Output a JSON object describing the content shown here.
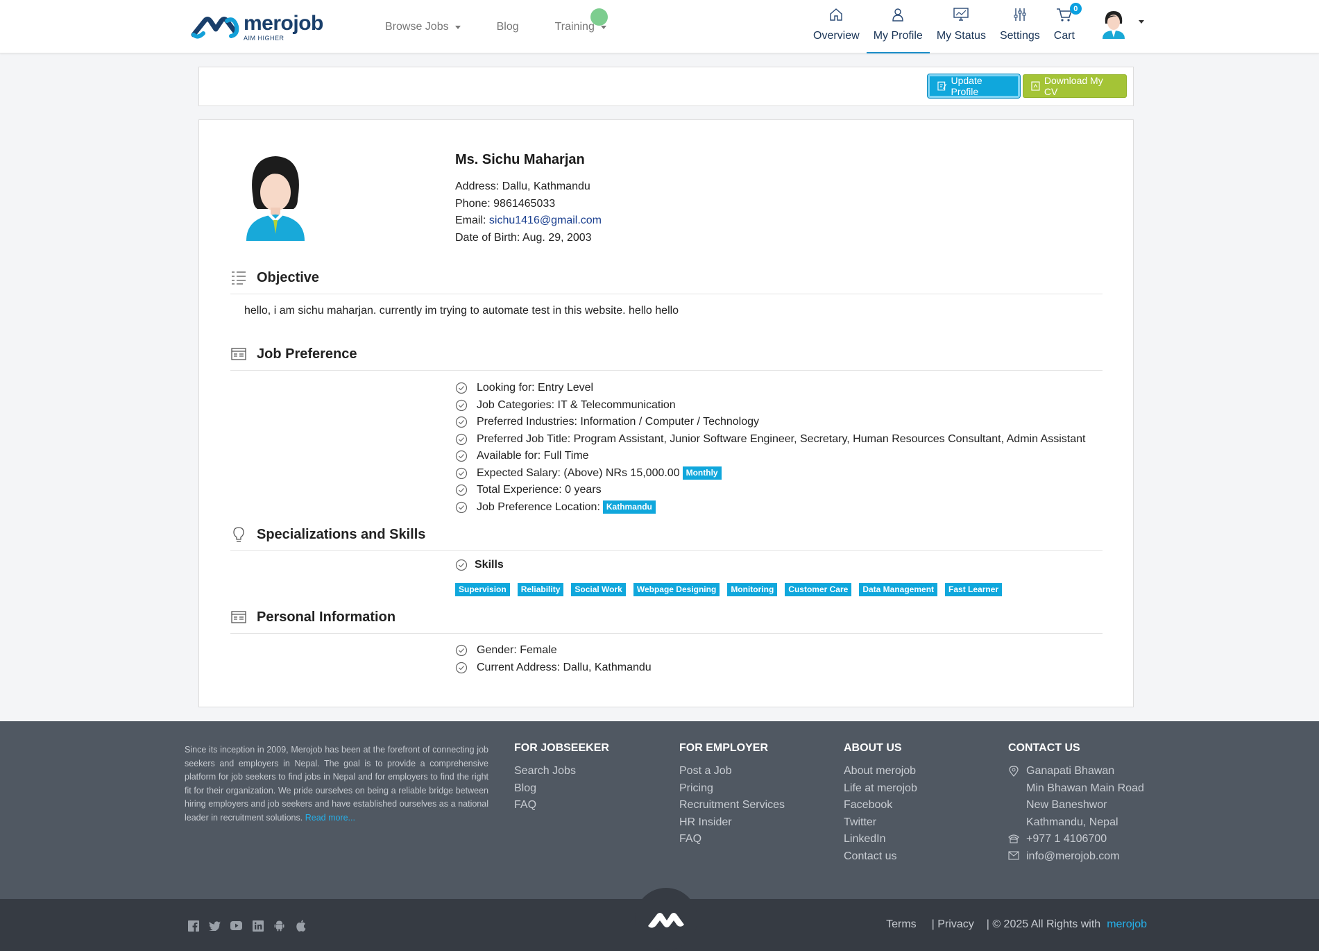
{
  "brand": {
    "name": "merojob",
    "tagline": "AIM HIGHER"
  },
  "nav": {
    "main": [
      {
        "label": "Browse Jobs",
        "dropdown": true
      },
      {
        "label": "Blog",
        "dropdown": false
      },
      {
        "label": "Training",
        "dropdown": true
      }
    ],
    "user": [
      {
        "label": "Overview",
        "icon": "home-icon"
      },
      {
        "label": "My Profile",
        "icon": "user-icon",
        "active": true
      },
      {
        "label": "My Status",
        "icon": "monitor-icon"
      },
      {
        "label": "Settings",
        "icon": "sliders-icon"
      },
      {
        "label": "Cart",
        "icon": "cart-icon",
        "badge": "0"
      }
    ]
  },
  "actions": {
    "update": "Update Profile",
    "download": "Download My CV"
  },
  "profile": {
    "name": "Ms. Sichu Maharjan",
    "address": "Address: Dallu, Kathmandu",
    "phone": "Phone: 9861465033",
    "email_label": "Email: ",
    "email": "sichu1416@gmail.com",
    "dob": "Date of Birth: Aug. 29, 2003"
  },
  "objective": {
    "title": "Objective",
    "text": "hello, i am sichu maharjan. currently im trying to automate test in this website. hello hello"
  },
  "job_preference": {
    "title": "Job Preference",
    "items": [
      "Looking for: Entry Level",
      "Job Categories: IT & Telecommunication",
      "Preferred Industries: Information / Computer / Technology",
      "Preferred Job Title: Program Assistant, Junior Software Engineer, Secretary, Human Resources Consultant, Admin Assistant",
      "Available for: Full Time",
      "Expected Salary: (Above) NRs 15,000.00",
      "Total Experience: 0 years",
      "Job Preference Location:"
    ],
    "salary_badge": "Monthly",
    "location_badge": "Kathmandu"
  },
  "skills": {
    "title": "Specializations and Skills",
    "label": "Skills",
    "items": [
      "Supervision",
      "Reliability",
      "Social Work",
      "Webpage Designing",
      "Monitoring",
      "Customer Care",
      "Data Management",
      "Fast Learner"
    ]
  },
  "personal": {
    "title": "Personal Information",
    "items": [
      "Gender: Female",
      "Current Address: Dallu, Kathmandu"
    ]
  },
  "footer": {
    "about": "Since its inception in 2009, Merojob has been at the forefront of connecting job seekers and employers in Nepal. The goal is to provide a comprehensive platform for job seekers to find jobs in Nepal and for employers to find the right fit for their organization. We pride ourselves on being a reliable bridge between hiring employers and job seekers and have established ourselves as a national leader in recruitment solutions.",
    "read_more": "Read more...",
    "jobseeker": {
      "title": "FOR JOBSEEKER",
      "links": [
        "Search Jobs",
        "Blog",
        "FAQ"
      ]
    },
    "employer": {
      "title": "FOR EMPLOYER",
      "links": [
        "Post a Job",
        "Pricing",
        "Recruitment Services",
        "HR Insider",
        "FAQ"
      ]
    },
    "about_us": {
      "title": "ABOUT US",
      "links": [
        "About merojob",
        "Life at merojob",
        "Facebook",
        "Twitter",
        "LinkedIn",
        "Contact us"
      ]
    },
    "contact": {
      "title": "CONTACT US",
      "address": [
        "Ganapati Bhawan",
        "Min Bhawan Main Road",
        "New Baneshwor",
        "Kathmandu, Nepal"
      ],
      "phone": "+977 1 4106700",
      "email": "info@merojob.com"
    },
    "legal": {
      "terms": "Terms",
      "privacy": "| Privacy",
      "copyright": "| © 2025 All Rights with",
      "brand": "merojob"
    },
    "social": [
      "facebook-icon",
      "twitter-icon",
      "youtube-icon",
      "linkedin-icon",
      "android-icon",
      "apple-icon"
    ]
  },
  "colors": {
    "primary": "#10a7dc",
    "download": "#a4c436",
    "navy": "#1a3f6b",
    "footer": "#505862",
    "bottombar": "#363b43"
  }
}
